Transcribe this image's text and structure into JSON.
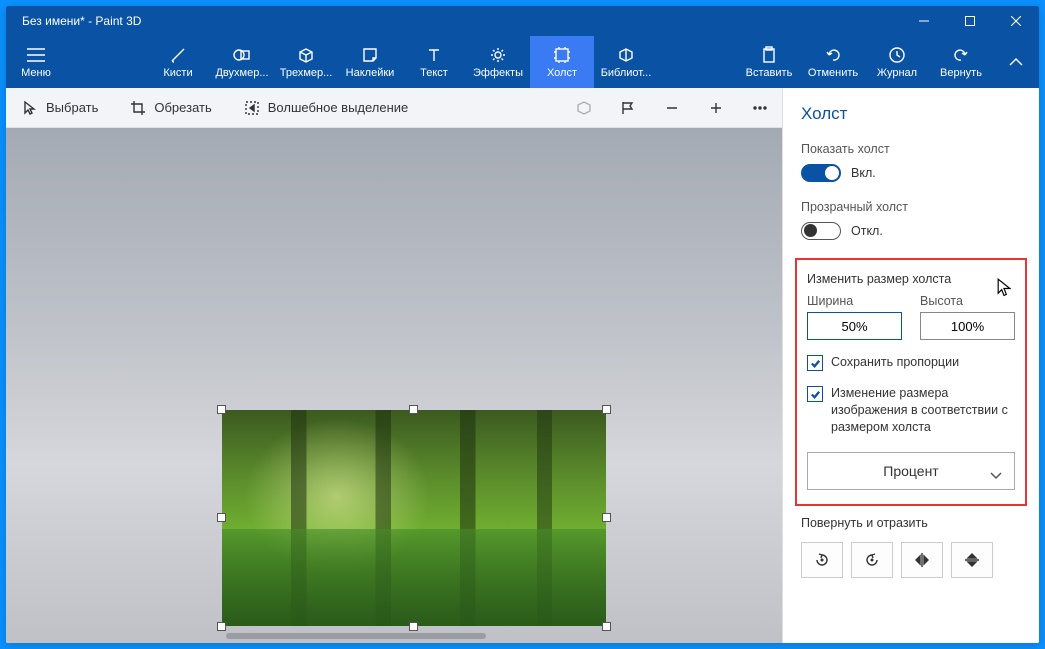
{
  "window": {
    "title": "Без имени* - Paint 3D"
  },
  "ribbon": {
    "menu": "Меню",
    "brushes": "Кисти",
    "shapes2d": "Двухмер...",
    "shapes3d": "Трехмер...",
    "stickers": "Наклейки",
    "text": "Текст",
    "effects": "Эффекты",
    "canvas": "Холст",
    "library": "Библиот...",
    "paste": "Вставить",
    "undo": "Отменить",
    "history": "Журнал",
    "redo": "Вернуть"
  },
  "toolbar": {
    "select": "Выбрать",
    "crop": "Обрезать",
    "magic_select": "Волшебное выделение"
  },
  "panel": {
    "title": "Холст",
    "show_canvas": "Показать холст",
    "on": "Вкл.",
    "transparent_canvas": "Прозрачный холст",
    "off": "Откл.",
    "resize_canvas": "Изменить размер холста",
    "width_label": "Ширина",
    "height_label": "Высота",
    "width_value": "50%",
    "height_value": "100%",
    "lock_aspect": "Сохранить пропорции",
    "resize_image": "Изменение размера изображения в соответствии с размером холста",
    "unit": "Процент",
    "rotate_flip": "Повернуть и отразить"
  }
}
